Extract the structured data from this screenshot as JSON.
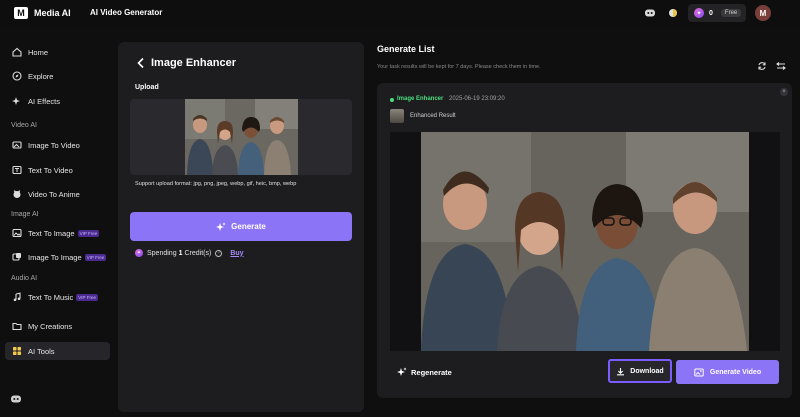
{
  "header": {
    "logo_text": "M",
    "brand": "Media AI",
    "app_title": "AI Video Generator",
    "credits": "0",
    "free_badge": "Free",
    "avatar_initial": "M"
  },
  "sidebar": {
    "home": "Home",
    "explore": "Explore",
    "ai_effects": "AI Effects",
    "section_video": "Video AI",
    "image_to_video": "Image To Video",
    "text_to_video": "Text To Video",
    "video_to_anime": "Video To Anime",
    "section_image": "Image AI",
    "text_to_image": "Text To Image",
    "image_to_image": "Image To Image",
    "section_audio": "Audio AI",
    "text_to_music": "Text To Music",
    "my_creations": "My Creations",
    "ai_tools": "AI Tools",
    "vip_badge": "VIP Free"
  },
  "tool": {
    "title": "Image Enhancer",
    "upload_label": "Upload",
    "support_text": "Support upload format: jpg, png, jpeg, webp, gif, heic, bmp, webp",
    "generate_label": "Generate",
    "spending_prefix": "Spending",
    "spending_amount": "1",
    "spending_suffix": "Credit(s)",
    "buy_label": "Buy"
  },
  "generate_list": {
    "title": "Generate List",
    "subtitle": "Your task results will be kept for 7 days. Please check them in time.",
    "result": {
      "status": "Image Enhancer",
      "timestamp": "2025-06-19 23:09:20",
      "label": "Enhanced Result",
      "regenerate_label": "Regenerate",
      "download_label": "Download",
      "generate_video_label": "Generate Video"
    }
  },
  "colors": {
    "accent": "#8b74f5",
    "highlight_border": "#7b5cff",
    "status_green": "#4ade80"
  }
}
